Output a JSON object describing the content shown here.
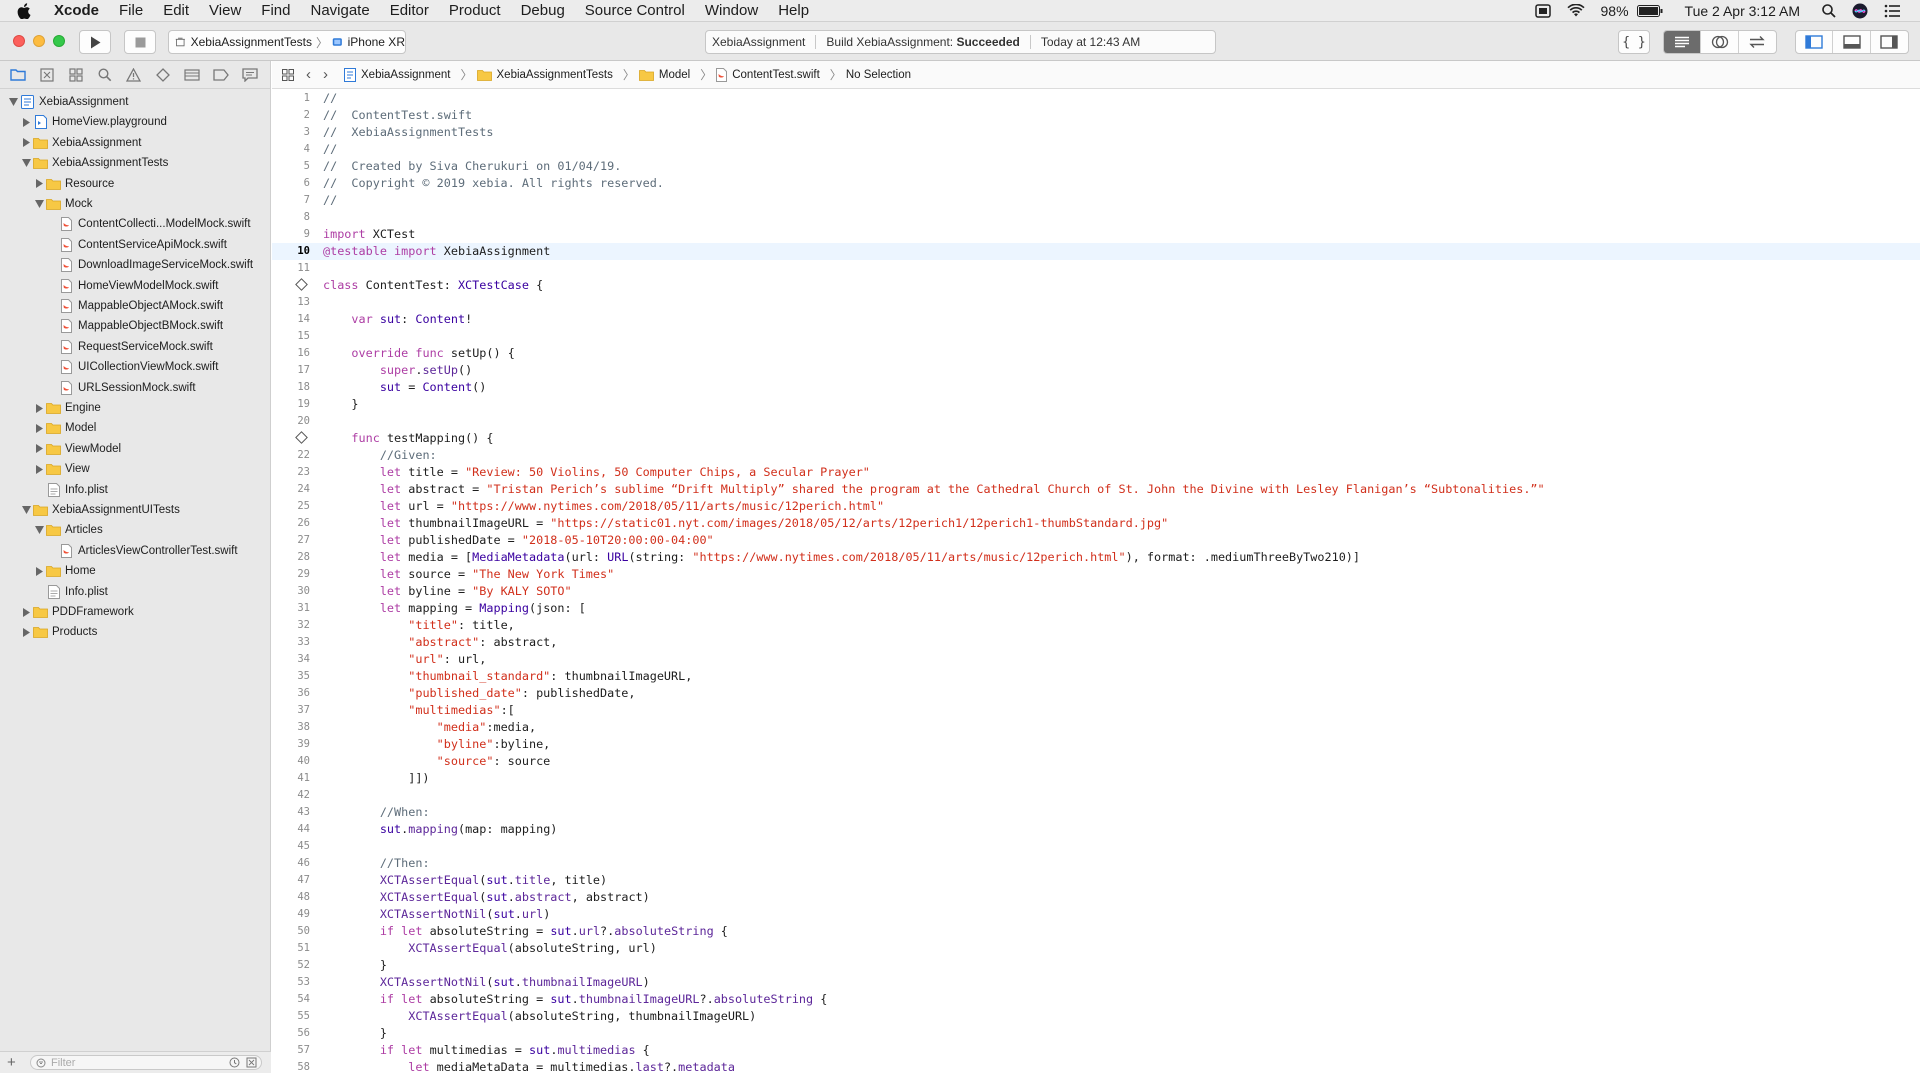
{
  "menubar": {
    "app_name": "Xcode",
    "items": [
      "File",
      "Edit",
      "View",
      "Find",
      "Navigate",
      "Editor",
      "Product",
      "Debug",
      "Source Control",
      "Window",
      "Help"
    ],
    "battery": "98%",
    "clock": "Tue 2 Apr  3:12 AM"
  },
  "toolbar": {
    "scheme": "XebiaAssignmentTests",
    "device": "iPhone XR",
    "activity_project": "XebiaAssignment",
    "activity_status_prefix": "Build XebiaAssignment: ",
    "activity_status": "Succeeded",
    "activity_time": "Today at 12:43 AM"
  },
  "navigator": {
    "filter_placeholder": "Filter",
    "tree": [
      {
        "label": "XebiaAssignment",
        "depth": 0,
        "kind": "project",
        "open": true
      },
      {
        "label": "HomeView.playground",
        "depth": 1,
        "kind": "playground",
        "open": false
      },
      {
        "label": "XebiaAssignment",
        "depth": 1,
        "kind": "folder",
        "open": false
      },
      {
        "label": "XebiaAssignmentTests",
        "depth": 1,
        "kind": "folder",
        "open": true
      },
      {
        "label": "Resource",
        "depth": 2,
        "kind": "folder",
        "open": false
      },
      {
        "label": "Mock",
        "depth": 2,
        "kind": "folder",
        "open": true
      },
      {
        "label": "ContentCollecti...ModelMock.swift",
        "depth": 3,
        "kind": "file"
      },
      {
        "label": "ContentServiceApiMock.swift",
        "depth": 3,
        "kind": "file"
      },
      {
        "label": "DownloadImageServiceMock.swift",
        "depth": 3,
        "kind": "file"
      },
      {
        "label": "HomeViewModelMock.swift",
        "depth": 3,
        "kind": "file"
      },
      {
        "label": "MappableObjectAMock.swift",
        "depth": 3,
        "kind": "file"
      },
      {
        "label": "MappableObjectBMock.swift",
        "depth": 3,
        "kind": "file"
      },
      {
        "label": "RequestServiceMock.swift",
        "depth": 3,
        "kind": "file"
      },
      {
        "label": "UICollectionViewMock.swift",
        "depth": 3,
        "kind": "file"
      },
      {
        "label": "URLSessionMock.swift",
        "depth": 3,
        "kind": "file"
      },
      {
        "label": "Engine",
        "depth": 2,
        "kind": "folder",
        "open": false
      },
      {
        "label": "Model",
        "depth": 2,
        "kind": "folder",
        "open": false
      },
      {
        "label": "ViewModel",
        "depth": 2,
        "kind": "folder",
        "open": false
      },
      {
        "label": "View",
        "depth": 2,
        "kind": "folder",
        "open": false
      },
      {
        "label": "Info.plist",
        "depth": 2,
        "kind": "plist"
      },
      {
        "label": "XebiaAssignmentUITests",
        "depth": 1,
        "kind": "folder",
        "open": true
      },
      {
        "label": "Articles",
        "depth": 2,
        "kind": "folder",
        "open": true
      },
      {
        "label": "ArticlesViewControllerTest.swift",
        "depth": 3,
        "kind": "file"
      },
      {
        "label": "Home",
        "depth": 2,
        "kind": "folder",
        "open": false
      },
      {
        "label": "Info.plist",
        "depth": 2,
        "kind": "plist"
      },
      {
        "label": "PDDFramework",
        "depth": 1,
        "kind": "folder",
        "open": false
      },
      {
        "label": "Products",
        "depth": 1,
        "kind": "folder",
        "open": false
      }
    ]
  },
  "jumpbar": {
    "crumbs": [
      "XebiaAssignment",
      "XebiaAssignmentTests",
      "Model",
      "ContentTest.swift",
      "No Selection"
    ]
  },
  "editor": {
    "current_line": 10,
    "lines": [
      "//",
      "//  ContentTest.swift",
      "//  XebiaAssignmentTests",
      "//",
      "//  Created by Siva Cherukuri on 01/04/19.",
      "//  Copyright © 2019 xebia. All rights reserved.",
      "//",
      "",
      "import XCTest",
      "@testable import XebiaAssignment",
      "",
      "class ContentTest: XCTestCase {",
      "",
      "    var sut: Content!",
      "",
      "    override func setUp() {",
      "        super.setUp()",
      "        sut = Content()",
      "    }",
      "",
      "    func testMapping() {",
      "        //Given:",
      "        let title = \"Review: 50 Violins, 50 Computer Chips, a Secular Prayer\"",
      "        let abstract = \"Tristan Perich’s sublime “Drift Multiply” shared the program at the Cathedral Church of St. John the Divine with Lesley Flanigan’s “Subtonalities.”\"",
      "        let url = \"https://www.nytimes.com/2018/05/11/arts/music/12perich.html\"",
      "        let thumbnailImageURL = \"https://static01.nyt.com/images/2018/05/12/arts/12perich1/12perich1-thumbStandard.jpg\"",
      "        let publishedDate = \"2018-05-10T20:00:00-04:00\"",
      "        let media = [MediaMetadata(url: URL(string: \"https://www.nytimes.com/2018/05/11/arts/music/12perich.html\"), format: .mediumThreeByTwo210)]",
      "        let source = \"The New York Times\"",
      "        let byline = \"By KALY SOTO\"",
      "        let mapping = Mapping(json: [",
      "            \"title\": title,",
      "            \"abstract\": abstract,",
      "            \"url\": url,",
      "            \"thumbnail_standard\": thumbnailImageURL,",
      "            \"published_date\": publishedDate,",
      "            \"multimedias\":[",
      "                \"media\":media,",
      "                \"byline\":byline,",
      "                \"source\": source",
      "            ]])",
      "",
      "        //When:",
      "        sut.mapping(map: mapping)",
      "",
      "        //Then:",
      "        XCTAssertEqual(sut.title, title)",
      "        XCTAssertEqual(sut.abstract, abstract)",
      "        XCTAssertNotNil(sut.url)",
      "        if let absoluteString = sut.url?.absoluteString {",
      "            XCTAssertEqual(absoluteString, url)",
      "        }",
      "        XCTAssertNotNil(sut.thumbnailImageURL)",
      "        if let absoluteString = sut.thumbnailImageURL?.absoluteString {",
      "            XCTAssertEqual(absoluteString, thumbnailImageURL)",
      "        }",
      "        if let multimedias = sut.multimedias {",
      "            let mediaMetaData = multimedias.last?.metadata"
    ],
    "test_diamond_lines": [
      12,
      21
    ]
  },
  "colors": {
    "keyword": "#ad3da4",
    "comment": "#5d6c79",
    "string": "#d12f1b",
    "type": "#3900a0",
    "folder": "#f7c844",
    "selected_segment": "#6c6c6c"
  }
}
